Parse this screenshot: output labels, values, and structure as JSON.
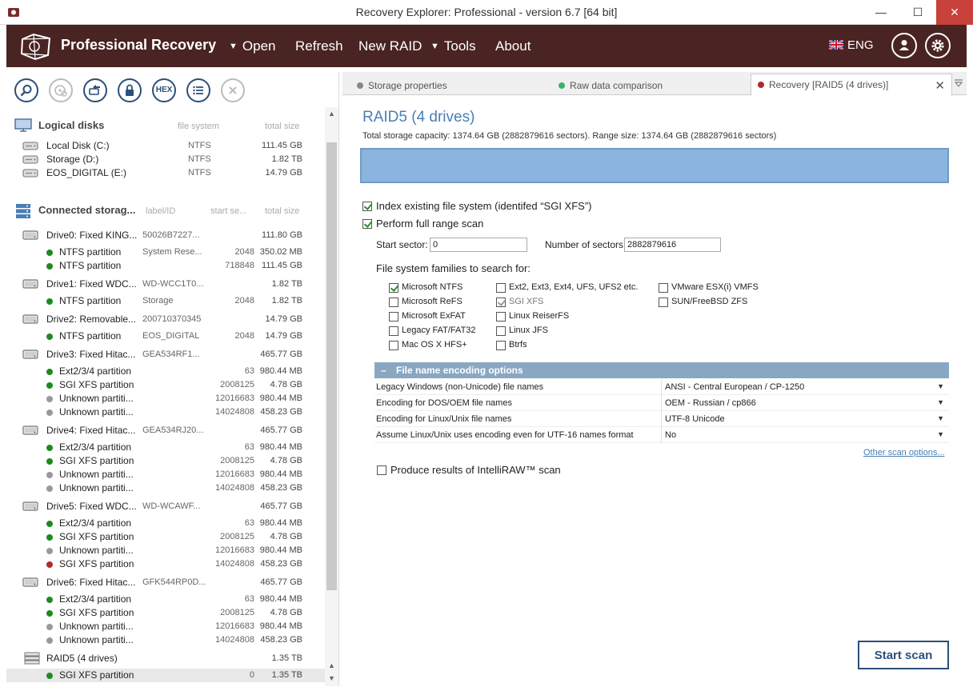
{
  "window": {
    "title": "Recovery Explorer: Professional - version 6.7 [64 bit]",
    "minimize": "—",
    "maximize": "☐",
    "close": "✕"
  },
  "menubar": {
    "brand": "Professional Recovery",
    "items": [
      {
        "label": "Open",
        "has_caret": true
      },
      {
        "label": "Refresh",
        "has_caret": false
      },
      {
        "label": "New RAID",
        "has_caret": false
      },
      {
        "label": "Tools",
        "has_caret": true
      },
      {
        "label": "About",
        "has_caret": false
      }
    ],
    "caret": "▼",
    "language": "ENG"
  },
  "toolbar": {
    "hex_label": "HEX"
  },
  "logical_disks": {
    "title": "Logical disks",
    "col_fs": "file system",
    "col_size": "total size",
    "items": [
      {
        "name": "Local Disk (C:)",
        "fs": "NTFS",
        "size": "111.45 GB"
      },
      {
        "name": "Storage (D:)",
        "fs": "NTFS",
        "size": "1.82 TB"
      },
      {
        "name": "EOS_DIGITAL (E:)",
        "fs": "NTFS",
        "size": "14.79 GB"
      }
    ]
  },
  "connected_storages": {
    "title": "Connected storag...",
    "col_label": "label/ID",
    "col_start": "start se...",
    "col_size": "total size",
    "rows": [
      {
        "kind": "drive",
        "name": "Drive0: Fixed KING...",
        "label": "50026B7227...",
        "start": "",
        "size": "111.80 GB"
      },
      {
        "kind": "part",
        "status": "green",
        "name": "NTFS partition",
        "label": "System Rese...",
        "start": "2048",
        "size": "350.02 MB"
      },
      {
        "kind": "part",
        "status": "green",
        "name": "NTFS partition",
        "label": "",
        "start": "718848",
        "size": "111.45 GB"
      },
      {
        "kind": "drive",
        "name": "Drive1: Fixed WDC...",
        "label": "WD-WCC1T0...",
        "start": "",
        "size": "1.82 TB"
      },
      {
        "kind": "part",
        "status": "green",
        "name": "NTFS partition",
        "label": "Storage",
        "start": "2048",
        "size": "1.82 TB"
      },
      {
        "kind": "drive",
        "name": "Drive2: Removable...",
        "label": "200710370345",
        "start": "",
        "size": "14.79 GB"
      },
      {
        "kind": "part",
        "status": "green",
        "name": "NTFS partition",
        "label": "EOS_DIGITAL",
        "start": "2048",
        "size": "14.79 GB"
      },
      {
        "kind": "drive",
        "name": "Drive3: Fixed Hitac...",
        "label": "GEA534RF1...",
        "start": "",
        "size": "465.77 GB"
      },
      {
        "kind": "part",
        "status": "green",
        "name": "Ext2/3/4 partition",
        "label": "",
        "start": "63",
        "size": "980.44 MB"
      },
      {
        "kind": "part",
        "status": "green",
        "name": "SGI XFS partition",
        "label": "",
        "start": "2008125",
        "size": "4.78 GB"
      },
      {
        "kind": "part",
        "status": "gray",
        "name": "Unknown partiti...",
        "label": "",
        "start": "12016683",
        "size": "980.44 MB"
      },
      {
        "kind": "part",
        "status": "gray",
        "name": "Unknown partiti...",
        "label": "",
        "start": "14024808",
        "size": "458.23 GB"
      },
      {
        "kind": "drive",
        "name": "Drive4: Fixed Hitac...",
        "label": "GEA534RJ20...",
        "start": "",
        "size": "465.77 GB"
      },
      {
        "kind": "part",
        "status": "green",
        "name": "Ext2/3/4 partition",
        "label": "",
        "start": "63",
        "size": "980.44 MB"
      },
      {
        "kind": "part",
        "status": "green",
        "name": "SGI XFS partition",
        "label": "",
        "start": "2008125",
        "size": "4.78 GB"
      },
      {
        "kind": "part",
        "status": "gray",
        "name": "Unknown partiti...",
        "label": "",
        "start": "12016683",
        "size": "980.44 MB"
      },
      {
        "kind": "part",
        "status": "gray",
        "name": "Unknown partiti...",
        "label": "",
        "start": "14024808",
        "size": "458.23 GB"
      },
      {
        "kind": "drive",
        "name": "Drive5: Fixed WDC...",
        "label": "WD-WCAWF...",
        "start": "",
        "size": "465.77 GB"
      },
      {
        "kind": "part",
        "status": "green",
        "name": "Ext2/3/4 partition",
        "label": "",
        "start": "63",
        "size": "980.44 MB"
      },
      {
        "kind": "part",
        "status": "green",
        "name": "SGI XFS partition",
        "label": "",
        "start": "2008125",
        "size": "4.78 GB"
      },
      {
        "kind": "part",
        "status": "gray",
        "name": "Unknown partiti...",
        "label": "",
        "start": "12016683",
        "size": "980.44 MB"
      },
      {
        "kind": "part",
        "status": "red",
        "name": "SGI XFS partition",
        "label": "",
        "start": "14024808",
        "size": "458.23 GB"
      },
      {
        "kind": "drive",
        "name": "Drive6: Fixed Hitac...",
        "label": "GFK544RP0D...",
        "start": "",
        "size": "465.77 GB"
      },
      {
        "kind": "part",
        "status": "green",
        "name": "Ext2/3/4 partition",
        "label": "",
        "start": "63",
        "size": "980.44 MB"
      },
      {
        "kind": "part",
        "status": "green",
        "name": "SGI XFS partition",
        "label": "",
        "start": "2008125",
        "size": "4.78 GB"
      },
      {
        "kind": "part",
        "status": "gray",
        "name": "Unknown partiti...",
        "label": "",
        "start": "12016683",
        "size": "980.44 MB"
      },
      {
        "kind": "part",
        "status": "gray",
        "name": "Unknown partiti...",
        "label": "",
        "start": "14024808",
        "size": "458.23 GB"
      },
      {
        "kind": "raid",
        "name": "RAID5 (4 drives)",
        "label": "",
        "start": "",
        "size": "1.35 TB"
      },
      {
        "kind": "part",
        "status": "green",
        "name": "SGI XFS partition",
        "label": "",
        "start": "0",
        "size": "1.35 TB",
        "selected": true
      }
    ]
  },
  "status_colors": {
    "green": "#1e8a1e",
    "gray": "#999999",
    "red": "#b02a2a"
  },
  "tabs": [
    {
      "label": "Storage properties",
      "dot": "#888888",
      "active": false
    },
    {
      "label": "Raw data comparison",
      "dot": "#3bb36b",
      "active": false
    },
    {
      "label": "Recovery [RAID5 (4 drives)]",
      "dot": "#b02a2a",
      "active": true
    }
  ],
  "tab_close": "✕",
  "recovery": {
    "title": "RAID5 (4 drives)",
    "capacity": "Total storage capacity: 1374.64 GB (2882879616 sectors). Range size: 1374.64 GB (2882879616 sectors)",
    "index_existing": {
      "label": "Index existing file system (identifed “SGI XFS”)",
      "checked": true
    },
    "full_range": {
      "label": "Perform full range scan",
      "checked": true
    },
    "start_sector_label": "Start sector:",
    "start_sector_value": "0",
    "num_sectors_label": "Number of sectors:",
    "num_sectors_value": "2882879616",
    "fs_families_label": "File system families to search for:",
    "fs_families": [
      [
        {
          "label": "Microsoft NTFS",
          "checked": true
        },
        {
          "label": "Microsoft ReFS",
          "checked": false
        },
        {
          "label": "Microsoft ExFAT",
          "checked": false
        },
        {
          "label": "Legacy FAT/FAT32",
          "checked": false
        },
        {
          "label": "Mac OS X HFS+",
          "checked": false
        }
      ],
      [
        {
          "label": "Ext2, Ext3, Ext4, UFS, UFS2 etc.",
          "checked": false
        },
        {
          "label": "SGI XFS",
          "checked": true,
          "dim": true
        },
        {
          "label": "Linux ReiserFS",
          "checked": false
        },
        {
          "label": "Linux JFS",
          "checked": false
        },
        {
          "label": "Btrfs",
          "checked": false
        }
      ],
      [
        {
          "label": "VMware ESX(i) VMFS",
          "checked": false
        },
        {
          "label": "SUN/FreeBSD ZFS",
          "checked": false
        }
      ]
    ],
    "encoding_header": "File name encoding options",
    "encoding_toggle": "–",
    "encoding_rows": [
      {
        "key": "Legacy Windows (non-Unicode) file names",
        "value": "ANSI - Central European / CP-1250"
      },
      {
        "key": "Encoding for DOS/OEM file names",
        "value": "OEM - Russian / cp866"
      },
      {
        "key": "Encoding for Linux/Unix file names",
        "value": "UTF-8 Unicode"
      },
      {
        "key": "Assume Linux/Unix uses encoding even for UTF-16 names format",
        "value": "No"
      }
    ],
    "dropdown_arrow": "▼",
    "other_options": "Other scan options...",
    "intelliraw": {
      "label": "Produce results of IntelliRAW™ scan",
      "checked": false
    },
    "start_scan": "Start scan"
  }
}
